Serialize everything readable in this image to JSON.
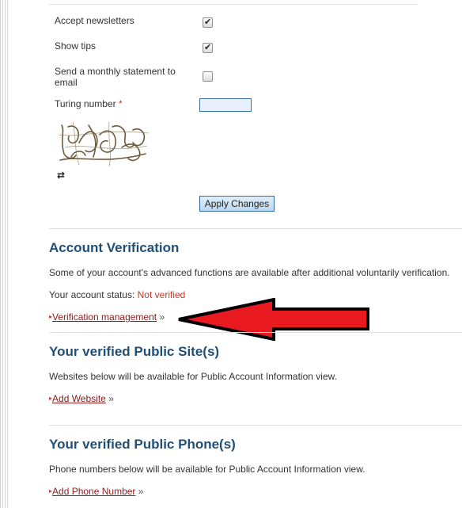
{
  "settings": {
    "accept_newsletters_label": "Accept newsletters",
    "accept_newsletters_checked": true,
    "show_tips_label": "Show tips",
    "show_tips_checked": true,
    "monthly_statement_label_line1": "Send a monthly statement to",
    "monthly_statement_label_line2": "email",
    "monthly_statement_checked": false,
    "turing_label": "Turing number",
    "required_marker": "*",
    "turing_value": "",
    "check_mark_glyph": "✔",
    "refresh_glyph": "⇄",
    "apply_button_label": "Apply Changes"
  },
  "account_verification": {
    "title": "Account Verification",
    "description": "Some of your account's advanced functions are available after additional voluntarily verification.",
    "status_label": "Your account status:",
    "status_value": "Not verified",
    "link_label": "Verification management",
    "link_suffix": "»",
    "bullet": "▸"
  },
  "public_sites": {
    "title": "Your verified Public Site(s)",
    "description": "Websites below will be available for Public Account Information view.",
    "link_label": "Add Website",
    "link_suffix": "»"
  },
  "public_phones": {
    "title": "Your verified Public Phone(s)",
    "description": "Phone numbers below will be available for Public Account Information view.",
    "link_label": "Add Phone Number",
    "link_suffix": "»"
  },
  "colors": {
    "heading": "#1f4f78",
    "link": "#8b1a1a",
    "status_not_verified": "#c0392b",
    "arrow_fill": "#e8191f"
  },
  "icons": {
    "refresh": "refresh-icon",
    "checkbox_check": "check-icon",
    "annotation_arrow": "red-arrow-icon"
  }
}
